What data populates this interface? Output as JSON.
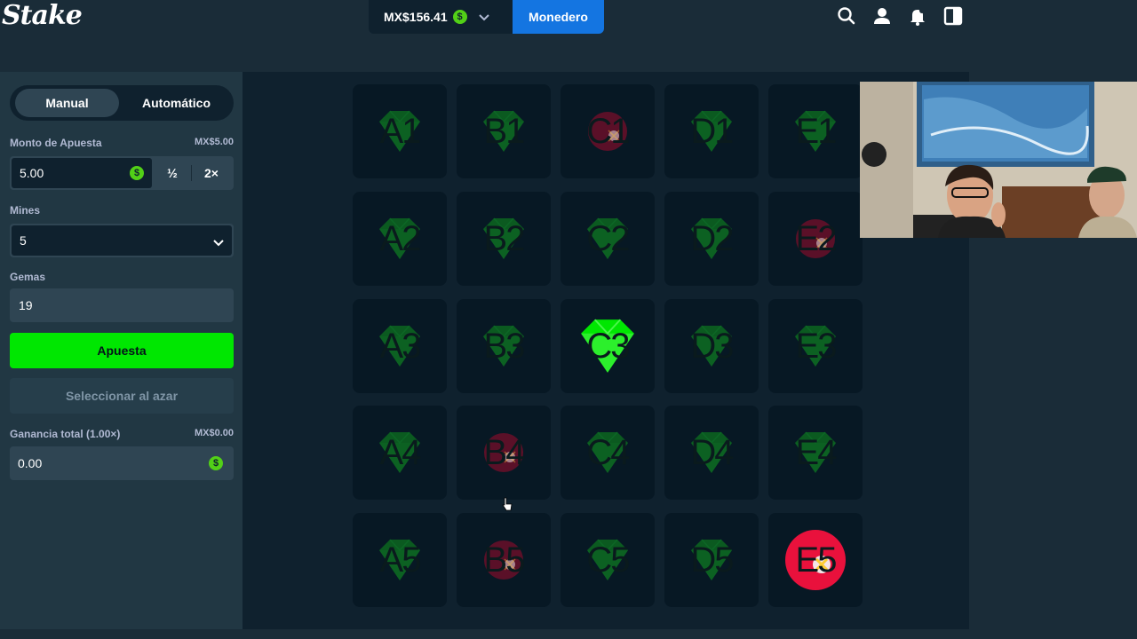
{
  "header": {
    "logo": "Stake",
    "balance": "MX$156.41",
    "currency_icon": "dollar-coin-icon",
    "wallet_label": "Monedero",
    "icons": [
      "search-icon",
      "user-icon",
      "bell-icon",
      "sidebar-toggle-icon"
    ]
  },
  "panel": {
    "tabs": [
      {
        "label": "Manual",
        "active": true
      },
      {
        "label": "Automático",
        "active": false
      }
    ],
    "bet_amount": {
      "label": "Monto de Apuesta",
      "converted": "MX$5.00",
      "value": "5.00",
      "half_label": "½",
      "double_label": "2×"
    },
    "mines": {
      "label": "Mines",
      "value": "5"
    },
    "gems": {
      "label": "Gemas",
      "value": "19"
    },
    "bet_button": "Apuesta",
    "random_button": "Seleccionar al azar",
    "profit": {
      "label": "Ganancia total (1.00×)",
      "converted": "MX$0.00",
      "value": "0.00"
    }
  },
  "board": {
    "columns": [
      "A",
      "B",
      "C",
      "D",
      "E"
    ],
    "rows": [
      "1",
      "2",
      "3",
      "4",
      "5"
    ],
    "tiles": [
      {
        "id": "A1",
        "type": "gem",
        "revealed": false
      },
      {
        "id": "B1",
        "type": "gem",
        "revealed": false
      },
      {
        "id": "C1",
        "type": "mine",
        "revealed": false
      },
      {
        "id": "D1",
        "type": "gem",
        "revealed": false
      },
      {
        "id": "E1",
        "type": "gem",
        "revealed": false
      },
      {
        "id": "A2",
        "type": "gem",
        "revealed": false
      },
      {
        "id": "B2",
        "type": "gem",
        "revealed": false
      },
      {
        "id": "C2",
        "type": "gem",
        "revealed": false
      },
      {
        "id": "D2",
        "type": "gem",
        "revealed": false
      },
      {
        "id": "E2",
        "type": "mine",
        "revealed": false
      },
      {
        "id": "A3",
        "type": "gem",
        "revealed": false
      },
      {
        "id": "B3",
        "type": "gem",
        "revealed": false
      },
      {
        "id": "C3",
        "type": "gem",
        "revealed": true
      },
      {
        "id": "D3",
        "type": "gem",
        "revealed": false
      },
      {
        "id": "E3",
        "type": "gem",
        "revealed": false
      },
      {
        "id": "A4",
        "type": "gem",
        "revealed": false
      },
      {
        "id": "B4",
        "type": "mine",
        "revealed": false
      },
      {
        "id": "C4",
        "type": "gem",
        "revealed": false
      },
      {
        "id": "D4",
        "type": "gem",
        "revealed": false
      },
      {
        "id": "E4",
        "type": "gem",
        "revealed": false
      },
      {
        "id": "A5",
        "type": "gem",
        "revealed": false
      },
      {
        "id": "B5",
        "type": "mine",
        "revealed": false
      },
      {
        "id": "C5",
        "type": "gem",
        "revealed": false
      },
      {
        "id": "D5",
        "type": "gem",
        "revealed": false
      },
      {
        "id": "E5",
        "type": "mine",
        "revealed": true
      }
    ]
  },
  "colors": {
    "bg": "#1a2c38",
    "panel": "#213743",
    "game_bg": "#0f212e",
    "accent_green": "#00e701",
    "wallet_blue": "#1475e1",
    "gem_dim": "#0b5a20",
    "gem_bright": "#00e701",
    "mine_dim": "#5a1028",
    "mine_bright": "#e9113c"
  }
}
